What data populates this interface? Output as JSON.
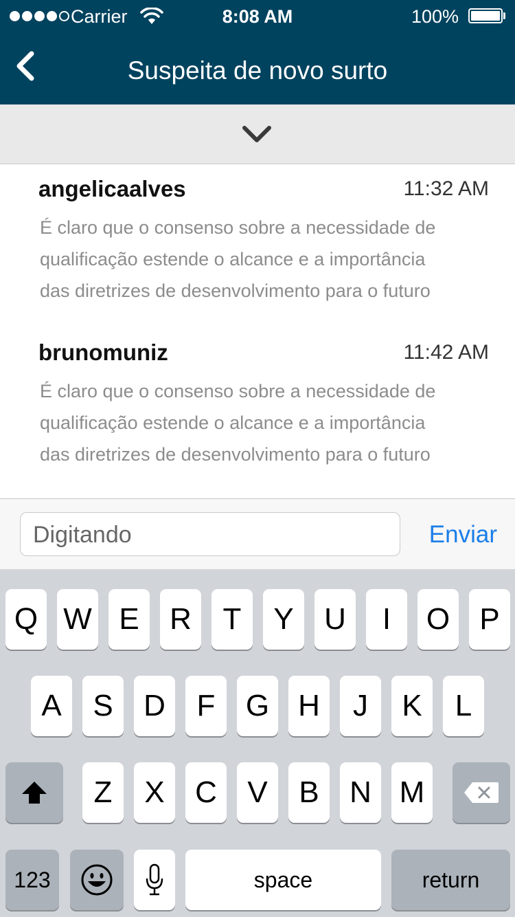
{
  "status_bar": {
    "carrier": "Carrier",
    "time": "8:08 AM",
    "battery": "100%"
  },
  "nav": {
    "title": "Suspeita de novo surto"
  },
  "messages": [
    {
      "user": "angelicaalves",
      "time": "11:32 AM",
      "lines": [
        "É claro que o consenso sobre a necessidade de",
        "qualificação estende o alcance e a importância",
        "das diretrizes de desenvolvimento para o futuro"
      ]
    },
    {
      "user": "brunomuniz",
      "time": "11:42 AM",
      "lines": [
        "É claro que o consenso sobre a necessidade de",
        "qualificação estende o alcance e a importância",
        "das diretrizes de desenvolvimento para o futuro"
      ]
    }
  ],
  "composer": {
    "placeholder": "Digitando",
    "send_label": "Enviar"
  },
  "keyboard": {
    "row1": [
      "Q",
      "W",
      "E",
      "R",
      "T",
      "Y",
      "U",
      "I",
      "O",
      "P"
    ],
    "row2": [
      "A",
      "S",
      "D",
      "F",
      "G",
      "H",
      "J",
      "K",
      "L"
    ],
    "row3": [
      "Z",
      "X",
      "C",
      "V",
      "B",
      "N",
      "M"
    ],
    "numbers": "123",
    "space": "space",
    "return": "return"
  },
  "colors": {
    "nav_bg": "#00435f",
    "accent": "#1a7ee8"
  }
}
